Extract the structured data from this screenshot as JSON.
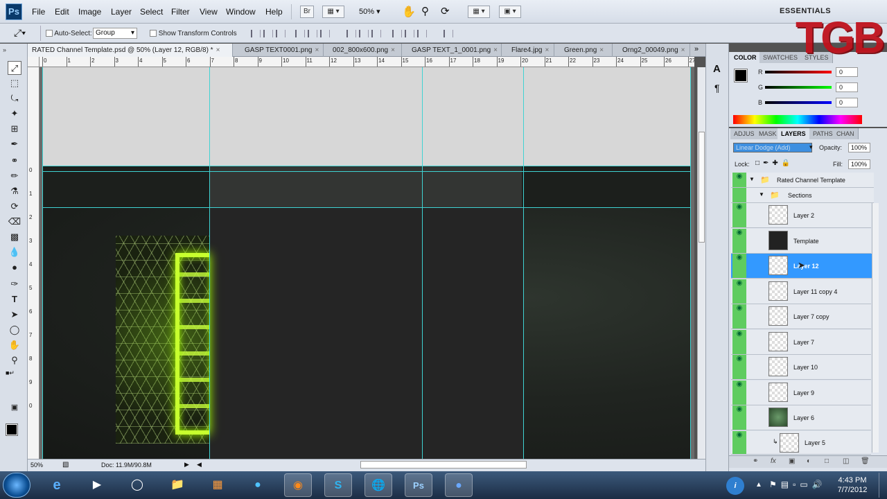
{
  "app": {
    "logo": "Ps",
    "workspace": "ESSENTIALS",
    "watermark": "TGB"
  },
  "menu": [
    "File",
    "Edit",
    "Image",
    "Layer",
    "Select",
    "Filter",
    "View",
    "Window",
    "Help"
  ],
  "menubar": {
    "bridge": "Br",
    "zoom": "50%"
  },
  "options": {
    "auto_select_label": "Auto-Select:",
    "auto_select_value": "Group",
    "transform_label": "Show Transform Controls"
  },
  "tabs": [
    "RATED Channel Template.psd @ 50% (Layer 12, RGB/8) *",
    "GASP TEXT0001.png",
    "002_800x600.png",
    "GASP TEXT_1_0001.png",
    "Flare4.jpg",
    "Green.png",
    "Orng2_00049.png"
  ],
  "ruler_h": [
    "0",
    "1",
    "2",
    "3",
    "4",
    "5",
    "6",
    "7",
    "8",
    "9",
    "10",
    "11",
    "12",
    "13",
    "14",
    "15",
    "16",
    "17",
    "18",
    "19",
    "20",
    "21",
    "22",
    "23",
    "24",
    "25",
    "26",
    "27"
  ],
  "ruler_v": [
    "0",
    "1",
    "2",
    "3",
    "4",
    "5",
    "6",
    "7",
    "8",
    "9",
    "0"
  ],
  "status": {
    "zoom": "50%",
    "doc": "Doc: 11.9M/90.8M"
  },
  "color_panel": {
    "tabs": [
      "COLOR",
      "SWATCHES",
      "STYLES"
    ],
    "r_label": "R",
    "g_label": "G",
    "b_label": "B",
    "r": "0",
    "g": "0",
    "b": "0"
  },
  "layers_panel": {
    "tabs": [
      "ADJUS",
      "MASK",
      "LAYERS",
      "PATHS",
      "CHAN"
    ],
    "blend_mode": "Linear Dodge (Add)",
    "opacity_label": "Opacity:",
    "opacity": "100%",
    "lock_label": "Lock:",
    "fill_label": "Fill:",
    "fill": "100%",
    "group_main": "Rated Channel Template",
    "group_sub": "Sections",
    "layers": [
      "Layer 2",
      "Template",
      "Layer 12",
      "Layer 11 copy 4",
      "Layer 7 copy",
      "Layer 7",
      "Layer 10",
      "Layer 9",
      "Layer 6",
      "Layer 5"
    ],
    "selected": "Layer 12"
  },
  "taskbar": {
    "time": "4:43 PM",
    "date": "7/7/2012"
  }
}
